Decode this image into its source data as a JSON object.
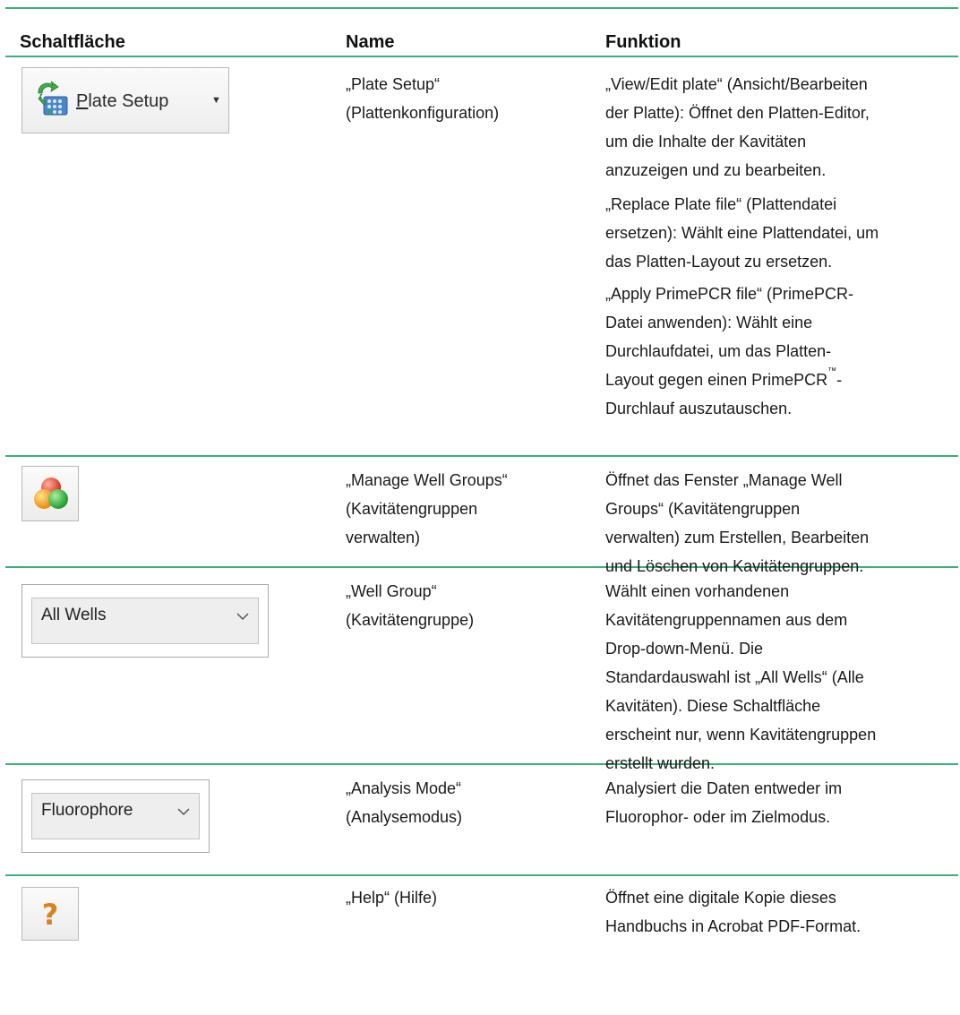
{
  "table": {
    "headers": [
      "Schaltfläche",
      "Name",
      "Funktion"
    ],
    "rows": [
      {
        "button": {
          "type": "menu-button",
          "label": "Plate Setup",
          "mnemonic": "P",
          "label_rest": "late Setup",
          "icon": "plate-setup-icon"
        },
        "name": [
          "„Plate Setup“",
          "(Plattenkonfiguration)"
        ],
        "function": [
          [
            "„View/Edit plate“ (Ansicht/Bearbeiten",
            "der Platte): Öffnet den Platten-Editor,",
            "um die Inhalte der Kavitäten",
            "anzuzeigen und zu bearbeiten."
          ],
          [
            "„Replace Plate file“ (Plattendatei",
            "ersetzen): Wählt eine Plattendatei, um",
            "das Platten-Layout zu ersetzen."
          ],
          [
            "„Apply PrimePCR file“ (PrimePCR-",
            "Datei anwenden): Wählt eine",
            "Durchlaufdatei, um das Platten-",
            "Layout gegen einen PrimePCR",
            "Durchlauf auszutauschen."
          ]
        ],
        "trademark": "™",
        "trademark_suffix": "-"
      },
      {
        "button": {
          "type": "icon-button",
          "icon": "well-groups-icon"
        },
        "name": [
          "„Manage Well Groups“",
          "(Kavitätengruppen",
          "verwalten)"
        ],
        "function": [
          [
            "Öffnet das Fenster „Manage Well",
            "Groups“ (Kavitätengruppen",
            "verwalten) zum Erstellen, Bearbeiten",
            "und Löschen von Kavitätengruppen."
          ]
        ]
      },
      {
        "button": {
          "type": "dropdown",
          "value": "All Wells",
          "icon": "chevron-down-icon"
        },
        "name": [
          "„Well Group“",
          "(Kavitätengruppe)"
        ],
        "function": [
          [
            "Wählt einen vorhandenen",
            "Kavitätengruppennamen aus dem",
            "Drop-down-Menü. Die",
            "Standardauswahl ist „All Wells“ (Alle",
            "Kavitäten). Diese Schaltfläche",
            "erscheint nur, wenn Kavitätengruppen",
            "erstellt wurden."
          ]
        ]
      },
      {
        "button": {
          "type": "dropdown",
          "value": "Fluorophore",
          "icon": "chevron-down-icon"
        },
        "name": [
          "„Analysis Mode“",
          "(Analysemodus)"
        ],
        "function": [
          [
            "Analysiert die Daten entweder im",
            "Fluorophor- oder im Zielmodus."
          ]
        ]
      },
      {
        "button": {
          "type": "icon-button",
          "icon": "help-question-icon",
          "glyph": "?"
        },
        "name": [
          "„Help“ (Hilfe)"
        ],
        "function": [
          [
            "Öffnet eine digitale Kopie dieses",
            "Handbuchs in Acrobat PDF-Format."
          ]
        ]
      }
    ]
  },
  "colors": {
    "rule": "#3fae7a",
    "help_glyph": "#d9821e"
  }
}
